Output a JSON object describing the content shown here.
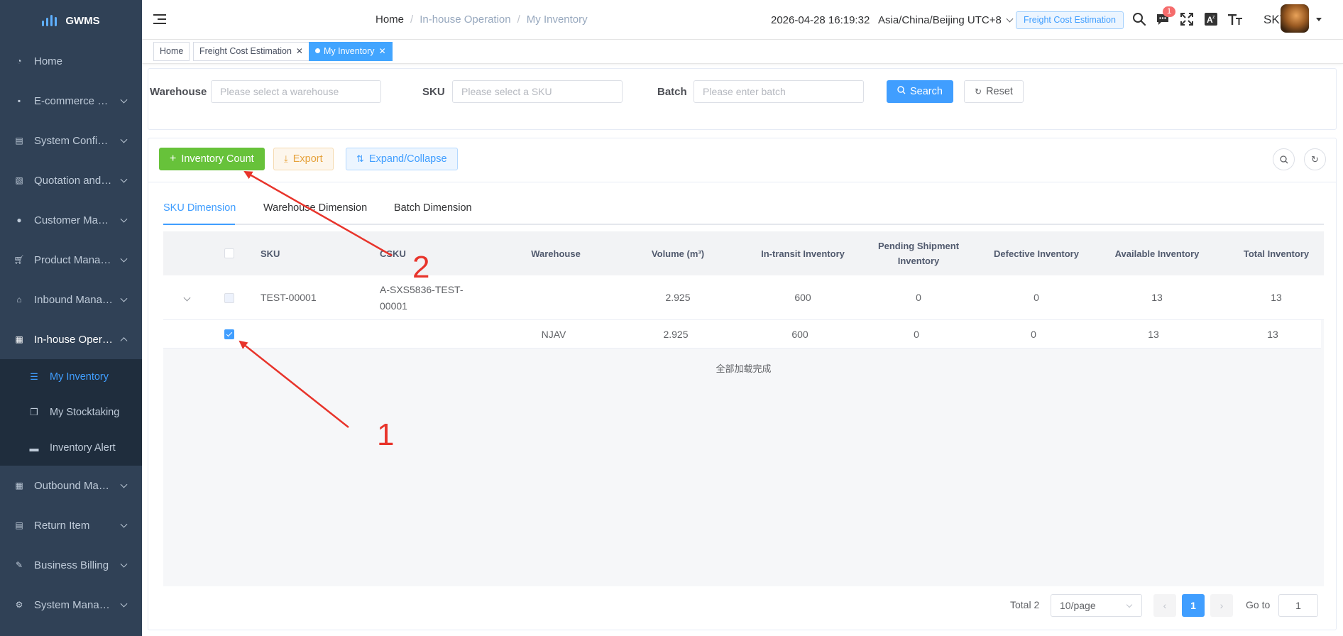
{
  "app": {
    "logo_text": "GWMS"
  },
  "sidebar": {
    "items": [
      {
        "label": "Home",
        "icon": "dashboard-icon",
        "has_children": false
      },
      {
        "label": "E-commerce Platform",
        "icon": "doc-icon",
        "has_children": true
      },
      {
        "label": "System Configuration",
        "icon": "doc-icon",
        "has_children": true
      },
      {
        "label": "Quotation and Billing",
        "icon": "doc-icon",
        "has_children": true
      },
      {
        "label": "Customer Management",
        "icon": "user-icon",
        "has_children": true
      },
      {
        "label": "Product Management",
        "icon": "cart-icon",
        "has_children": true
      },
      {
        "label": "Inbound Management",
        "icon": "home-icon",
        "has_children": true
      },
      {
        "label": "In-house Operation",
        "icon": "grid-icon",
        "has_children": true,
        "open": true
      },
      {
        "label": "Outbound Management",
        "icon": "grid-icon",
        "has_children": true
      },
      {
        "label": "Return Item",
        "icon": "form-icon",
        "has_children": true
      },
      {
        "label": "Business Billing",
        "icon": "edit-icon",
        "has_children": true
      },
      {
        "label": "System Management",
        "icon": "gear-icon",
        "has_children": true
      }
    ],
    "submenu": [
      {
        "label": "My Inventory",
        "icon": "list-icon",
        "active": true
      },
      {
        "label": "My Stocktaking",
        "icon": "copy-icon",
        "active": false
      },
      {
        "label": "Inventory Alert",
        "icon": "message-icon",
        "active": false
      }
    ]
  },
  "header": {
    "breadcrumb": [
      "Home",
      "In-house Operation",
      "My Inventory"
    ],
    "datetime": "2026-04-28 16:19:32",
    "timezone": "Asia/China/Beijing UTC+8",
    "freight_button": "Freight Cost Estimation",
    "notification_count": "1",
    "username": "SKY"
  },
  "tags": [
    {
      "label": "Home",
      "active": false,
      "closable": false
    },
    {
      "label": "Freight Cost Estimation",
      "active": false,
      "closable": true
    },
    {
      "label": "My Inventory",
      "active": true,
      "closable": true
    }
  ],
  "filters": {
    "warehouse_label": "Warehouse",
    "warehouse_placeholder": "Please select a warehouse",
    "sku_label": "SKU",
    "sku_placeholder": "Please select a SKU",
    "batch_label": "Batch",
    "batch_placeholder": "Please enter batch",
    "search_button": "Search",
    "reset_button": "Reset"
  },
  "toolbar": {
    "count_button": "Inventory Count",
    "export_button": "Export",
    "expand_button": "Expand/Collapse"
  },
  "tabs": [
    "SKU Dimension",
    "Warehouse Dimension",
    "Batch Dimension"
  ],
  "table": {
    "columns": [
      "SKU",
      "CSKU",
      "Warehouse",
      "Volume (m³)",
      "In-transit Inventory",
      "Pending Shipment Inventory",
      "Defective Inventory",
      "Available Inventory",
      "Total Inventory"
    ],
    "rows": [
      {
        "sku": "TEST-00001",
        "csku": "A-SXS5836-TEST-00001",
        "warehouse": "",
        "volume": "2.925",
        "in_transit": "600",
        "pending": "0",
        "defective": "0",
        "available": "13",
        "total": "13"
      },
      {
        "sku": "",
        "csku": "",
        "warehouse": "NJAV",
        "volume": "2.925",
        "in_transit": "600",
        "pending": "0",
        "defective": "0",
        "available": "13",
        "total": "13"
      }
    ],
    "loaded_text": "全部加载完成"
  },
  "pagination": {
    "total_text": "Total 2",
    "page_size": "10/page",
    "current_page": "1",
    "goto_label": "Go to",
    "goto_value": "1"
  },
  "annotations": [
    "1",
    "2"
  ],
  "colors": {
    "sidebar_bg": "#304156",
    "primary": "#409eff",
    "success": "#67c23a",
    "warning": "#e6a23c",
    "annotation": "#e8342b"
  }
}
